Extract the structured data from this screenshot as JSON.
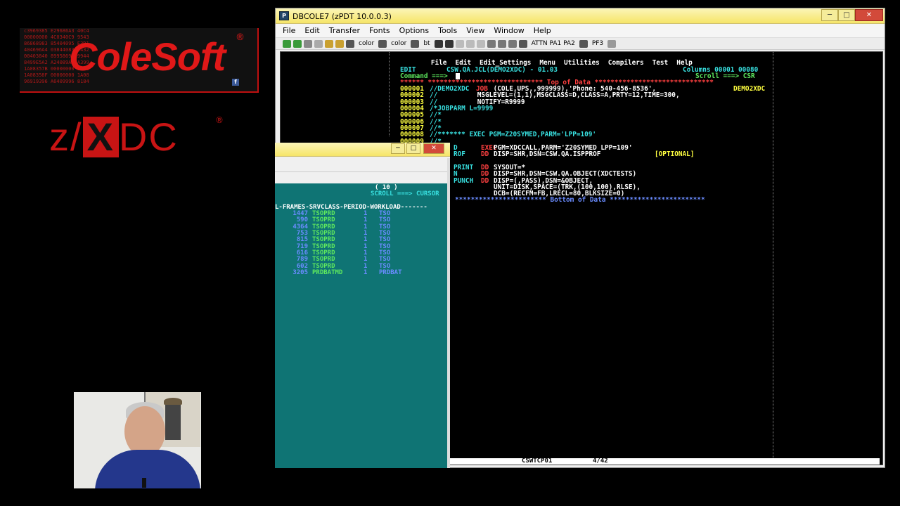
{
  "brand": {
    "company": "ColeSoft",
    "product_pre": "z/",
    "product_x": "X",
    "product_post": "DC",
    "registered": "®",
    "fb": "f",
    "hex_lines": [
      "c3969385 E29686A3 40C4",
      "00000000 4C0340C9 9543",
      "86868983 85404095 E3D1",
      "404696A4 03844083 9432",
      "00403840 8995869 89944",
      "8499E5A2 A24089A3 A399",
      "1A08357B 00000000 1A08",
      "1A08358F 00000000 1A08",
      "96919396 A6409996 8184"
    ]
  },
  "main_window": {
    "title": "DBCOLE7 (zPDT 10.0.0.3)",
    "minimize": "─",
    "maximize": "□",
    "close": "✕",
    "menu": [
      "File",
      "Edit",
      "Transfer",
      "Fonts",
      "Options",
      "Tools",
      "View",
      "Window",
      "Help"
    ],
    "toolbar_labels": {
      "color1": "color",
      "color2": "color",
      "bt": "bt",
      "attn": "ATTN PA1 PA2",
      "pf3": "PF3"
    },
    "ispf_menu": [
      "File",
      "Edit",
      "Edit_Settings",
      "Menu",
      "Utilities",
      "Compilers",
      "Test",
      "Help"
    ],
    "edit_label": "EDIT",
    "dataset": "CSW.QA.JCL(DEMO2XDC) - 01.03",
    "columns": "Columns 00001 00080",
    "command_label": "Command ===>",
    "scroll_label": "Scroll ===> CSR",
    "top_of_data": "****** ***************************** Top of Data ******************************",
    "lines": [
      {
        "num": "000001",
        "text": "//DEMO2XDC ",
        "kw": "JOB",
        "rest": " (COLE,UPS,,999999),'Phone: 540-456-8536',",
        "tag": "DEMO2XDC"
      },
      {
        "num": "000002",
        "text": "//",
        "kw": "",
        "rest": "            MSGLEVEL=(1,1),MSGCLASS=D,CLASS=A,PRTY=12,TIME=300,",
        "tag": ""
      },
      {
        "num": "000003",
        "text": "//",
        "kw": "",
        "rest": "            NOTIFY=R9999",
        "tag": ""
      },
      {
        "num": "000004",
        "text": "/*JOBPARM L=9999",
        "kw": "",
        "rest": "",
        "tag": ""
      },
      {
        "num": "000005",
        "text": "//*",
        "kw": "",
        "rest": "",
        "tag": ""
      },
      {
        "num": "000006",
        "text": "//*",
        "kw": "",
        "rest": "",
        "tag": ""
      },
      {
        "num": "000007",
        "text": "//*",
        "kw": "",
        "rest": "",
        "tag": ""
      },
      {
        "num": "000008",
        "text": "//******* EXEC PGM=Z20SYMED,PARM='LPP=109'",
        "kw": "",
        "rest": "",
        "tag": ""
      },
      {
        "num": "000009",
        "text": "//*",
        "kw": "",
        "rest": "",
        "tag": ""
      }
    ],
    "right_lines": [
      {
        "a": "D",
        "b": "EXEC",
        "c": "PGM=XDCCALL,PARM='Z20SYMED LPP=109'",
        "d": ""
      },
      {
        "a": "ROF",
        "b": "DD",
        "c": "DISP=SHR,DSN=CSW.QA.ISPPROF",
        "d": "[OPTIONAL]"
      },
      {
        "a": "",
        "b": "",
        "c": "",
        "d": ""
      },
      {
        "a": "PRINT",
        "b": "DD",
        "c": "SYSOUT=*",
        "d": ""
      },
      {
        "a": "N",
        "b": "DD",
        "c": "DISP=SHR,DSN=CSW.QA.OBJECT(XDCTESTS)",
        "d": ""
      },
      {
        "a": "PUNCH",
        "b": "DD",
        "c": "DISP=(,PASS),DSN=&OBJECT,",
        "d": ""
      },
      {
        "a": "",
        "b": "",
        "c": "UNIT=DISK,SPACE=(TRK,(100,100),RLSE),",
        "d": ""
      },
      {
        "a": "",
        "b": "",
        "c": "DCB=(RECFM=FB,LRECL=80,BLKSIZE=0)",
        "d": ""
      }
    ],
    "bottom_of_data": "*********************** Bottom of Data ************************",
    "status_session": "CSWTCP01",
    "status_pos": "4/42"
  },
  "second_window": {
    "minimize": "─",
    "maximize": "□",
    "close": "✕",
    "header1": "( 10 )",
    "header2": "SCROLL ===> CURSOR",
    "colhead": "L-FRAMES-SRVCLASS-PERIOD-WORKLOAD-------",
    "rows": [
      {
        "frames": "1447",
        "srvclass": "TSOPRD",
        "period": "1",
        "workload": "TSO"
      },
      {
        "frames": "590",
        "srvclass": "TSOPRD",
        "period": "1",
        "workload": "TSO"
      },
      {
        "frames": "4364",
        "srvclass": "TSOPRD",
        "period": "1",
        "workload": "TSO"
      },
      {
        "frames": "753",
        "srvclass": "TSOPRD",
        "period": "1",
        "workload": "TSO"
      },
      {
        "frames": "815",
        "srvclass": "TSOPRD",
        "period": "1",
        "workload": "TSO"
      },
      {
        "frames": "719",
        "srvclass": "TSOPRD",
        "period": "1",
        "workload": "TSO"
      },
      {
        "frames": "616",
        "srvclass": "TSOPRD",
        "period": "1",
        "workload": "TSO"
      },
      {
        "frames": "789",
        "srvclass": "TSOPRD",
        "period": "1",
        "workload": "TSO"
      },
      {
        "frames": "602",
        "srvclass": "TSOPRD",
        "period": "1",
        "workload": "TSO"
      },
      {
        "frames": "3205",
        "srvclass": "PRDBATMD",
        "period": "1",
        "workload": "PRDBAT"
      }
    ]
  }
}
